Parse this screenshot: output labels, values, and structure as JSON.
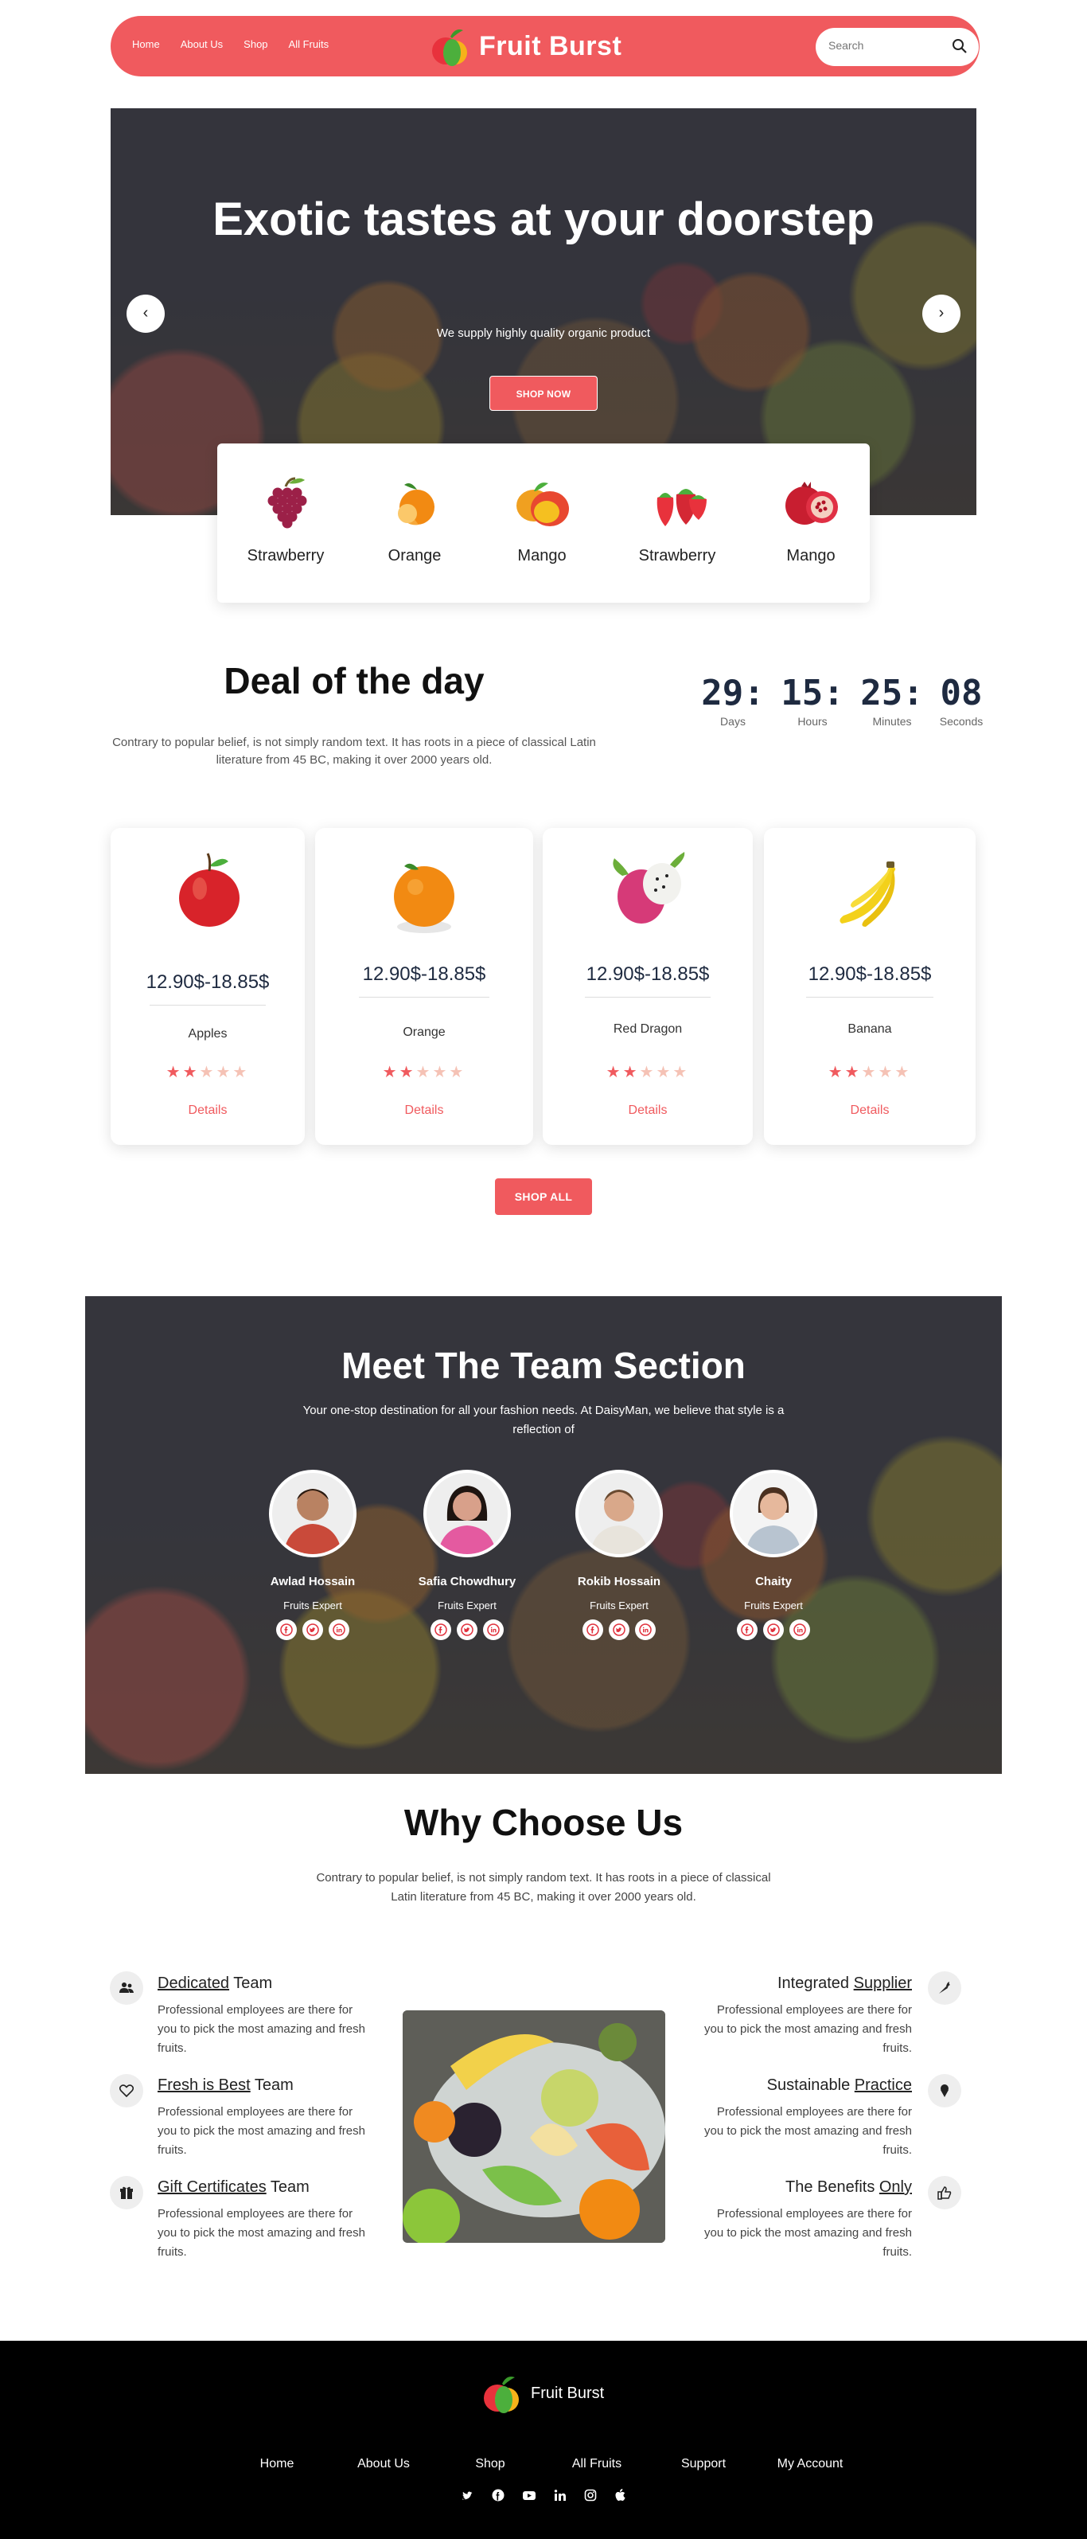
{
  "nav": {
    "links": [
      "Home",
      "About Us",
      "Shop",
      "All Fruits"
    ],
    "brand": "Fruit Burst",
    "search_placeholder": "Search"
  },
  "hero": {
    "title": "Exotic tastes at your doorstep",
    "subtitle": "We supply highly quality organic product",
    "button": "SHOP NOW"
  },
  "categories": [
    {
      "label": "Strawberry",
      "icon": "grapes-icon"
    },
    {
      "label": "Orange",
      "icon": "orange-icon"
    },
    {
      "label": "Mango",
      "icon": "mango-icon"
    },
    {
      "label": "Strawberry",
      "icon": "strawberry-icon"
    },
    {
      "label": "Mango",
      "icon": "pomegranate-icon"
    }
  ],
  "deal": {
    "title": "Deal of the day",
    "text": "Contrary to popular belief, is not simply random text. It has roots in a piece of classical Latin literature from 45 BC, making it over 2000 years old.",
    "countdown": [
      {
        "value": "29:",
        "unit": "Days"
      },
      {
        "value": "15:",
        "unit": "Hours"
      },
      {
        "value": "25:",
        "unit": "Minutes"
      },
      {
        "value": "08",
        "unit": "Seconds"
      }
    ]
  },
  "products": [
    {
      "price": "12.90$-18.85$",
      "name": "Apples",
      "details": "Details",
      "rating": 1.5
    },
    {
      "price": "12.90$-18.85$",
      "name": "Orange",
      "details": "Details",
      "rating": 1.5
    },
    {
      "price": "12.90$-18.85$",
      "name": "Red Dragon",
      "details": "Details",
      "rating": 1.5
    },
    {
      "price": "12.90$-18.85$",
      "name": "Banana",
      "details": "Details",
      "rating": 1.5
    }
  ],
  "shop_all": "SHOP ALL",
  "team": {
    "title": "Meet The Team Section",
    "subtitle": "Your one-stop destination for all your fashion needs. At DaisyMan, we believe that style is a reflection of",
    "members": [
      {
        "name": "Awlad Hossain",
        "role": "Fruits Expert"
      },
      {
        "name": "Safia Chowdhury",
        "role": "Fruits Expert"
      },
      {
        "name": "Rokib Hossain",
        "role": "Fruits Expert"
      },
      {
        "name": "Chaity",
        "role": "Fruits Expert"
      }
    ]
  },
  "why": {
    "title": "Why Choose Us",
    "text": "Contrary to popular belief, is not simply random text. It has roots in a piece of classical Latin literature from 45 BC, making it over 2000 years old.",
    "left": [
      {
        "title_u": "Dedicated",
        "title_rest": " Team",
        "desc": "Professional employees are there for you to pick the most amazing and fresh fruits.",
        "icon": "users-icon"
      },
      {
        "title_u": "Fresh is Best",
        "title_rest": " Team",
        "desc": "Professional employees are there for you to pick the most amazing and fresh fruits.",
        "icon": "heart-icon"
      },
      {
        "title_u": "Gift Certificates",
        "title_rest": " Team",
        "desc": "Professional employees are there for you to pick the most amazing and fresh fruits.",
        "icon": "gift-icon"
      }
    ],
    "right": [
      {
        "title_rest": "Integrated ",
        "title_u": "Supplier",
        "desc": "Professional employees are there for you to pick the most amazing and fresh fruits.",
        "icon": "carrot-icon"
      },
      {
        "title_rest": "Sustainable ",
        "title_u": "Practice",
        "desc": "Professional employees are there for you to pick the most amazing and fresh fruits.",
        "icon": "ice-cream-icon"
      },
      {
        "title_rest": "The Benefits ",
        "title_u": "Only",
        "desc": "Professional employees are there for you to pick the most amazing and fresh fruits.",
        "icon": "thumbs-up-icon"
      }
    ]
  },
  "footer": {
    "brand": "Fruit Burst",
    "links": [
      "Home",
      "About Us",
      "Shop",
      "All Fruits",
      "Support",
      "My Account"
    ],
    "social": [
      "twitter-icon",
      "facebook-icon",
      "youtube-icon",
      "linkedin-icon",
      "instagram-icon",
      "apple-icon"
    ]
  },
  "colors": {
    "accent": "#f05a5e",
    "dark": "#1e2a40",
    "footer": "#000000"
  }
}
